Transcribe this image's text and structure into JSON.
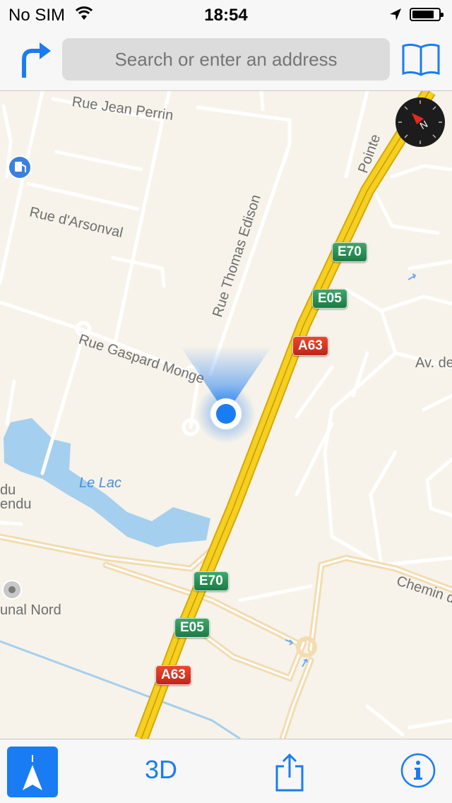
{
  "status_bar": {
    "carrier": "No SIM",
    "time": "18:54",
    "icons": [
      "wifi-icon",
      "location-arrow-icon",
      "battery-icon"
    ]
  },
  "nav_bar": {
    "search_placeholder": "Search or enter an address",
    "directions_icon": "turn-arrow-icon",
    "bookmarks_icon": "book-icon"
  },
  "map": {
    "street_labels": {
      "rue_jean_perrin": "Rue Jean Perrin",
      "rue_darsonval": "Rue d'Arsonval",
      "rue_thomas_edison": "Rue Thomas Edison",
      "rue_gaspard_monge": "Rue Gaspard Monge",
      "pointe": "Pointe",
      "av_de": "Av. de",
      "chemin": "Chemin d",
      "le_lac": "Le Lac",
      "du": "du",
      "endu": "endu",
      "unal_nord": "unal Nord"
    },
    "road_shields": {
      "e70_top": "E70",
      "e05_top": "E05",
      "a63_top": "A63",
      "e70_bottom": "E70",
      "e05_bottom": "E05",
      "a63_bottom": "A63"
    },
    "colors": {
      "land": "#f7f3ea",
      "motorway": "#f5cf21",
      "water": "#a5cfee",
      "user_location": "#1a7cf2"
    },
    "poi_icons": [
      "fuel-station-icon",
      "place-icon"
    ],
    "compass_icon": "compass-icon"
  },
  "toolbar": {
    "tracking_icon": "tracking-arrow-icon",
    "btn_3d": "3D",
    "share_icon": "share-icon",
    "info_icon": "info-icon",
    "accent": "#1a7cf2"
  }
}
